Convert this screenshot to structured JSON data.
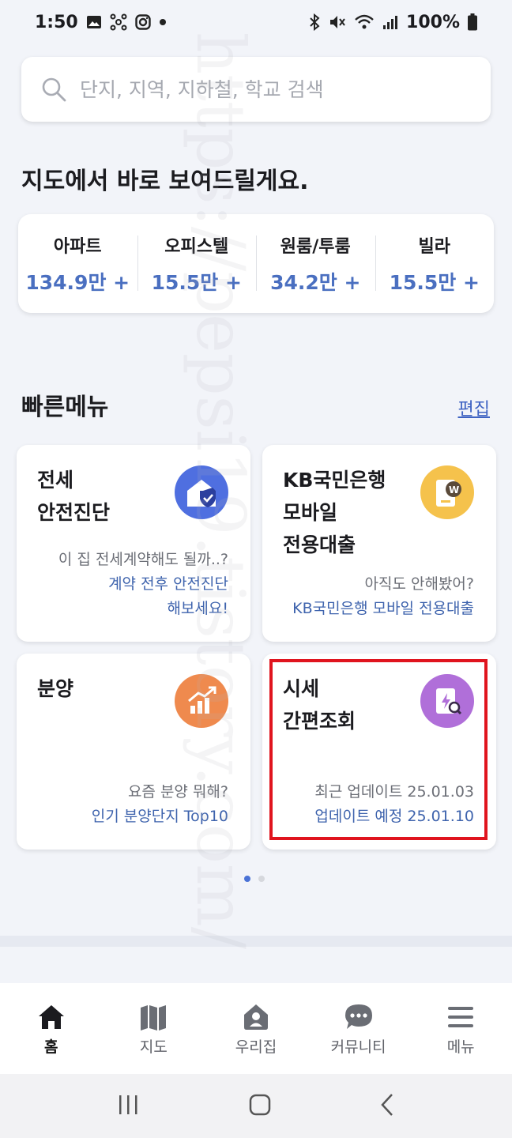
{
  "status": {
    "time": "1:50",
    "battery": "100%"
  },
  "search": {
    "placeholder": "단지, 지역, 지하철, 학교 검색"
  },
  "headline": "지도에서 바로 보여드릴게요.",
  "stats": [
    {
      "label": "아파트",
      "value": "134.9만 +"
    },
    {
      "label": "오피스텔",
      "value": "15.5만 +"
    },
    {
      "label": "원룸/투룸",
      "value": "34.2만 +"
    },
    {
      "label": "빌라",
      "value": "15.5만 +"
    }
  ],
  "quick_menu": {
    "title": "빠른메뉴",
    "edit_label": "편집",
    "cards": [
      {
        "title": "전세\n안전진단",
        "icon": "shield-home-icon",
        "icon_color": "#4f6fe0",
        "line1": "이 집 전세계약해도 될까..?",
        "line2": "계약 전후 안전진단",
        "line3": "해보세요!"
      },
      {
        "title": "KB국민은행\n모바일\n전용대출",
        "icon": "loan-phone-icon",
        "icon_color": "#f5c24c",
        "line1": "아직도 안해봤어?",
        "line2": "KB국민은행 모바일 전용대출",
        "line3": ""
      },
      {
        "title": "분양",
        "icon": "rising-chart-icon",
        "icon_color": "#ef8a4e",
        "line1": "요즘 분양 뭐해?",
        "line2": "인기 분양단지 Top10",
        "line3": ""
      },
      {
        "title": "시세\n간편조회",
        "icon": "price-search-icon",
        "icon_color": "#b06fd9",
        "line1": "최근 업데이트 25.01.03",
        "line2": "업데이트 예정 25.01.10",
        "line3": ""
      }
    ]
  },
  "watermark": "https://pepsi19.tistory.com/",
  "bottom_nav": [
    {
      "label": "홈",
      "icon": "home-icon",
      "active": true
    },
    {
      "label": "지도",
      "icon": "map-icon"
    },
    {
      "label": "우리집",
      "icon": "my-house-icon"
    },
    {
      "label": "커뮤니티",
      "icon": "chat-bubble-icon"
    },
    {
      "label": "메뉴",
      "icon": "hamburger-menu-icon"
    }
  ]
}
